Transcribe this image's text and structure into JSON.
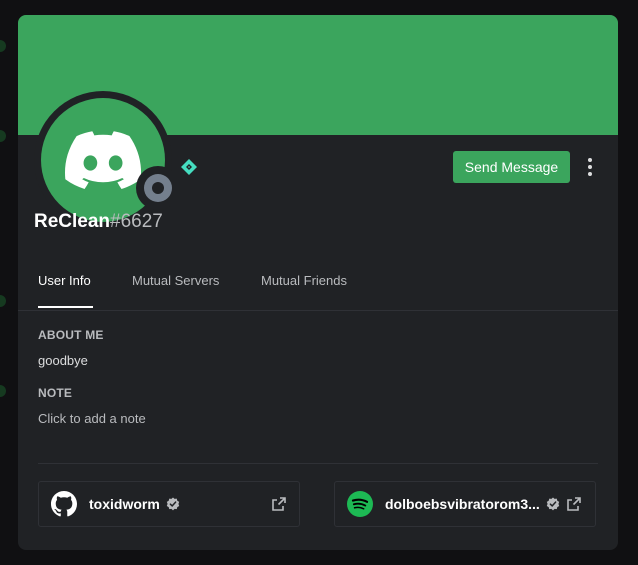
{
  "profile": {
    "username": "ReClean",
    "discriminator": "#6627",
    "status": "offline",
    "badge_icon": "hypesquad-balance-icon",
    "banner_color": "#3ba55d",
    "avatar_color": "#3ba55d"
  },
  "actions": {
    "send_message_label": "Send Message",
    "more_icon": "more-vertical-icon"
  },
  "tabs": [
    {
      "label": "User Info",
      "active": true
    },
    {
      "label": "Mutual Servers",
      "active": false
    },
    {
      "label": "Mutual Friends",
      "active": false
    }
  ],
  "about": {
    "heading": "ABOUT ME",
    "text": "goodbye"
  },
  "note": {
    "heading": "NOTE",
    "placeholder": "Click to add a note"
  },
  "connections": [
    {
      "service": "GitHub",
      "icon": "github-icon",
      "name": "toxidworm",
      "verified": true
    },
    {
      "service": "Spotify",
      "icon": "spotify-icon",
      "name": "dolboebsvibratorom3...",
      "verified": true
    }
  ],
  "colors": {
    "accent": "#3ba55d",
    "modal_bg": "#202225",
    "spotify": "#1db954"
  }
}
